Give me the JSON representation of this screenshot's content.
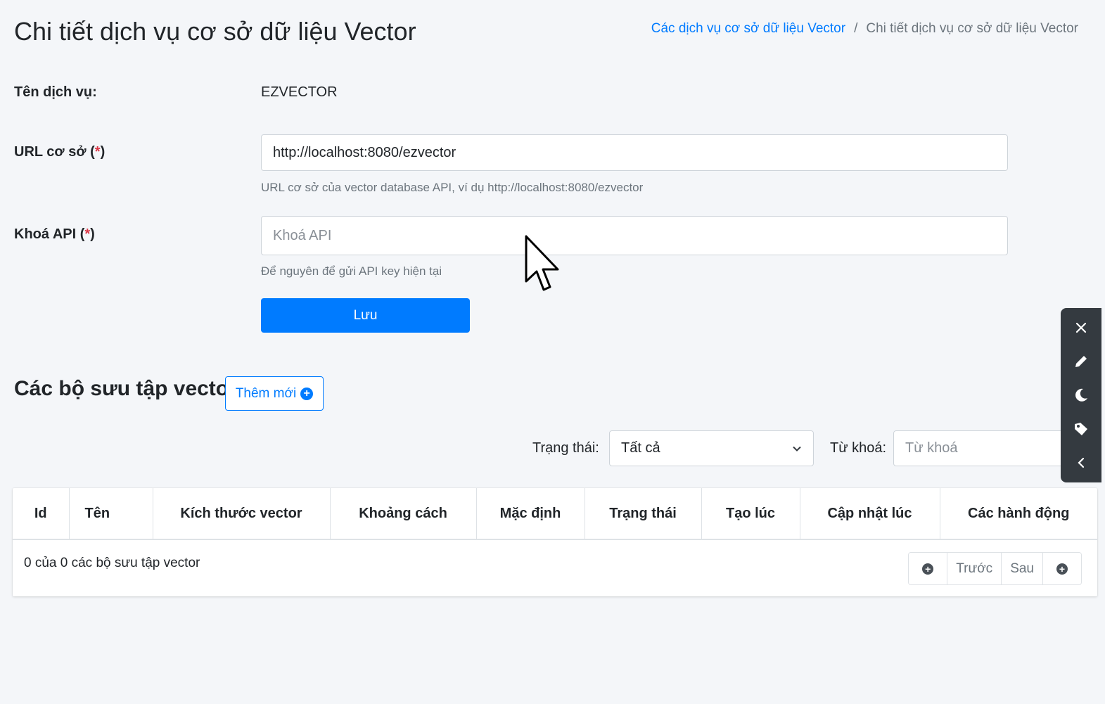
{
  "header": {
    "title": "Chi tiết dịch vụ cơ sở dữ liệu Vector",
    "breadcrumb": {
      "link": "Các dịch vụ cơ sở dữ liệu Vector",
      "separator": "/",
      "current": "Chi tiết dịch vụ cơ sở dữ liệu Vector"
    }
  },
  "form": {
    "service_name_label": "Tên dịch vụ:",
    "service_name_value": "EZVECTOR",
    "base_url_label": "URL cơ sở (",
    "base_url_required": "*",
    "base_url_label_end": ")",
    "base_url_value": "http://localhost:8080/ezvector",
    "base_url_help": "URL cơ sở của vector database API, ví dụ http://localhost:8080/ezvector",
    "api_key_label": "Khoá API (",
    "api_key_required": "*",
    "api_key_label_end": ")",
    "api_key_placeholder": "Khoá API",
    "api_key_help": "Để nguyên để gửi API key hiện tại",
    "save_label": "Lưu"
  },
  "collections": {
    "title": "Các bộ sưu tập vector",
    "add_label": "Thêm mới",
    "filters": {
      "status_label": "Trạng thái:",
      "status_selected": "Tất cả",
      "keyword_label": "Từ khoá:",
      "keyword_placeholder": "Từ khoá"
    },
    "columns": [
      "Id",
      "Tên",
      "Kích thước vector",
      "Khoảng cách",
      "Mặc định",
      "Trạng thái",
      "Tạo lúc",
      "Cập nhật lúc",
      "Các hành động"
    ],
    "summary": "0 của 0 các bộ sưu tập vector",
    "pagination": {
      "prev_label": "Trước",
      "next_label": "Sau"
    }
  },
  "toolbar": {
    "icons": [
      "close-icon",
      "pencil-icon",
      "moon-icon",
      "palette-icon",
      "chevron-left-icon"
    ]
  },
  "colors": {
    "primary": "#007bff",
    "required": "#dc3545",
    "toolbar_bg": "#343a40",
    "page_bg": "#f4f6f9"
  }
}
